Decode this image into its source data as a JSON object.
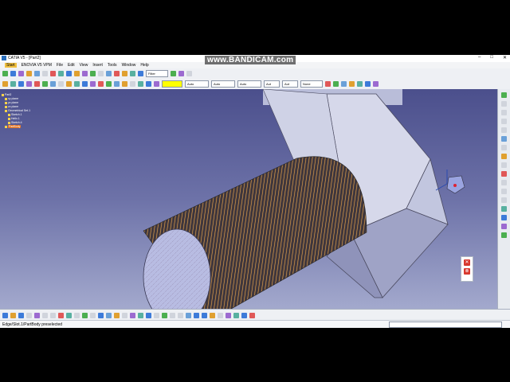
{
  "window": {
    "title": "CATIA V5 - [Part2]"
  },
  "watermark": "www.BANDICAM.com",
  "menu": {
    "items": [
      "Start",
      "ENOVIA V5 VPM",
      "File",
      "Edit",
      "View",
      "Insert",
      "Tools",
      "Window",
      "Help"
    ]
  },
  "toolbar": {
    "color_value": "",
    "layer_value": "Filter",
    "linetype_value": "Auto",
    "thickness_value": "Auto",
    "weight_value": "Auto",
    "line_value": "Aut",
    "transparency_value": "Aut",
    "layer2_value": "None"
  },
  "tree": {
    "items": [
      "Part2",
      "xy plane",
      "yz plane",
      "zx plane",
      "Geometrical Set.1",
      "Sketch.1",
      "Helix.1",
      "Sketch.4",
      "PartBody"
    ]
  },
  "status": {
    "text": "Edge/Slot.1/PartBody preselected"
  },
  "colors": {
    "accent": "#f0c040",
    "viewport_top": "#4b4f8c",
    "viewport_bottom": "#a3a9cd",
    "thread": "#e0a050",
    "bolt_head": "#c8cce4"
  },
  "icons": [
    "compass-icon",
    "stop-icon",
    "gear-icon",
    "select-icon",
    "zoom-icon",
    "pan-icon",
    "rotate-icon",
    "fit-all-icon",
    "save-icon",
    "open-icon",
    "new-icon",
    "undo-icon"
  ]
}
